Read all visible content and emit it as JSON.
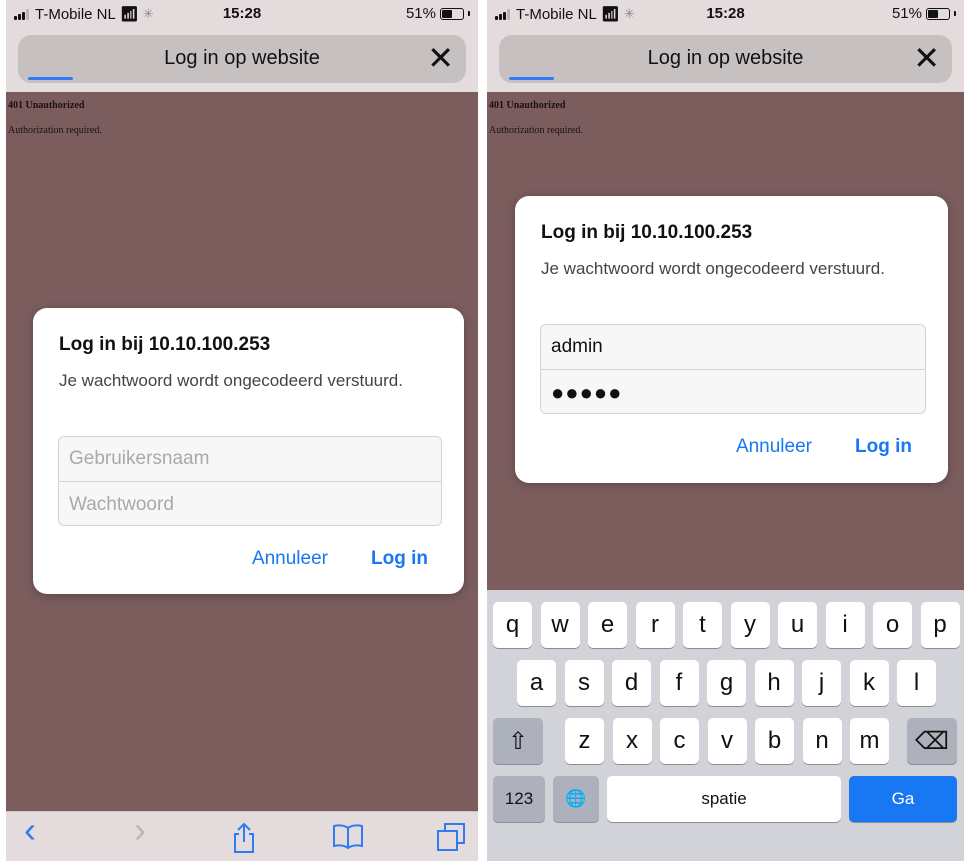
{
  "status": {
    "carrier": "T-Mobile NL",
    "time": "15:28",
    "battery": "51%",
    "battery_level": 0.51
  },
  "browser": {
    "title": "Log in op website",
    "close_icon": "✕",
    "load_progress": 0.12
  },
  "page": {
    "heading": "401 Unauthorized",
    "message": "Authorization required."
  },
  "dialog": {
    "title": "Log in bij 10.10.100.253",
    "message": "Je wachtwoord wordt ongecodeerd verstuurd.",
    "username_placeholder": "Gebruikersnaam",
    "password_placeholder": "Wachtwoord",
    "cancel_label": "Annuleer",
    "login_label": "Log in"
  },
  "dialog_filled": {
    "username_value": "admin",
    "password_value": "●●●●●"
  },
  "toolbar": {
    "back_icon": "‹",
    "forward_icon": "›",
    "share_icon": "⇪",
    "bookmarks_icon": "📖",
    "tabs_icon": "⧉"
  },
  "keyboard": {
    "row1": [
      "q",
      "w",
      "e",
      "r",
      "t",
      "y",
      "u",
      "i",
      "o",
      "p"
    ],
    "row2": [
      "a",
      "s",
      "d",
      "f",
      "g",
      "h",
      "j",
      "k",
      "l"
    ],
    "row3": [
      "z",
      "x",
      "c",
      "v",
      "b",
      "n",
      "m"
    ],
    "shift_icon": "⇧",
    "backspace_icon": "⌫",
    "numbers_label": "123",
    "globe_icon": "🌐",
    "space_label": "spatie",
    "go_label": "Ga"
  }
}
